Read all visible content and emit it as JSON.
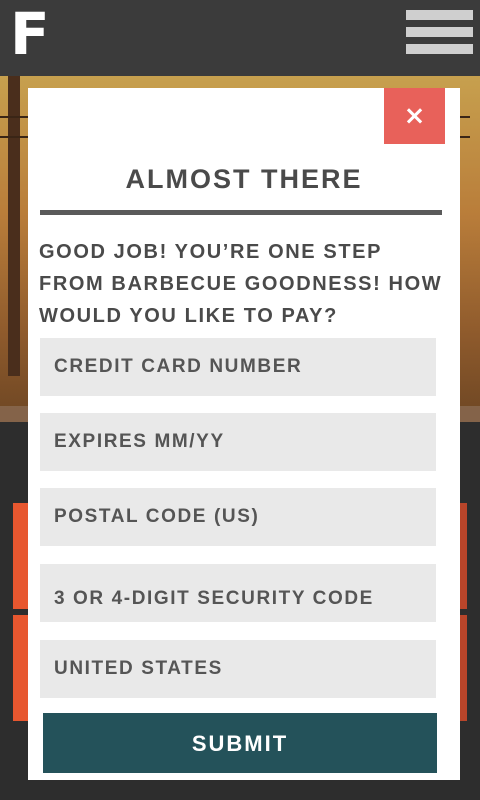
{
  "app": {
    "logo_letter": "F"
  },
  "modal": {
    "close_label": "×",
    "title": "ALMOST THERE",
    "message": "GOOD JOB! YOU’RE ONE STEP FROM BARBECUE GOODNESS! HOW WOULD YOU LIKE TO PAY?",
    "fields": {
      "card_number": "CREDIT CARD NUMBER",
      "expiry": "EXPIRES MM/YY",
      "postal_code": "POSTAL CODE (US)",
      "security_code": "3 OR 4-DIGIT SECURITY CODE",
      "country": "UNITED STATES"
    },
    "submit_label": "SUBMIT"
  },
  "colors": {
    "close": "#e8615a",
    "submit": "#24525a",
    "field_bg": "#e9e9e9",
    "accent": "#e7572f"
  },
  "icons": [
    "menu-icon",
    "close-icon"
  ]
}
